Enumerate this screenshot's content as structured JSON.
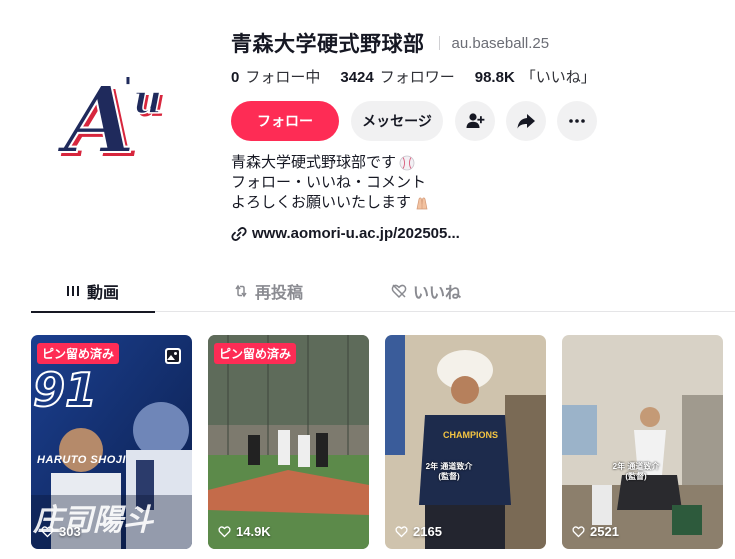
{
  "profile": {
    "display_name": "青森大学硬式野球部",
    "username": "au.baseball.25",
    "logo_text": "A'u"
  },
  "stats": [
    {
      "value": "0",
      "label": "フォロー中"
    },
    {
      "value": "3424",
      "label": "フォロワー"
    },
    {
      "value": "98.8K",
      "label": "「いいね」"
    }
  ],
  "actions": {
    "follow_label": "フォロー",
    "message_label": "メッセージ",
    "add_friend_icon": "person-plus-icon",
    "share_icon": "share-arrow-icon",
    "more_icon": "ellipsis-icon"
  },
  "bio": {
    "line1": "青森大学硬式野球部です",
    "line2": "フォロー・いいね・コメント",
    "line3": "よろしくお願いいたします"
  },
  "link": {
    "text": "www.aomori-u.ac.jp/202505..."
  },
  "tabs": [
    {
      "label": "動画",
      "icon": "grid-icon",
      "active": true
    },
    {
      "label": "再投稿",
      "icon": "repost-icon",
      "active": false
    },
    {
      "label": "いいね",
      "icon": "heart-slash-icon",
      "active": false
    }
  ],
  "videos": [
    {
      "pinned_label": "ピン留め済み",
      "views": "303",
      "overlay_number": "91",
      "overlay_name": "HARUTO SHOJI",
      "overlay_kanji": "庄司陽斗"
    },
    {
      "pinned_label": "ピン留め済み",
      "views": "14.9K"
    },
    {
      "views": "2165",
      "caption": "2年 通道致介\n(監督)",
      "shirt_text": "CHAMPIONS"
    },
    {
      "views": "2521",
      "caption": "2年 通道致介\n(監督)"
    }
  ],
  "colors": {
    "accent": "#fe2c55",
    "text": "#161823",
    "muted": "#8a8b91",
    "logo_navy": "#1f2a5c",
    "logo_red": "#d7263d"
  }
}
